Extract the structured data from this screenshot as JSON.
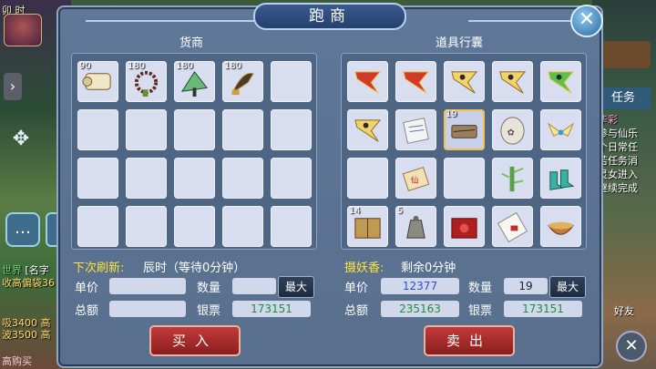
{
  "hud": {
    "time": "卯 时",
    "channel_label": "世界",
    "channel_text": "[名字",
    "line1": "收高偏袋36",
    "line2": "吸3400 高",
    "line3": "波3500 高",
    "bunny": "高购买",
    "task_tab": "任务",
    "task_lines": [
      "华彩",
      "参与仙乐",
      "个日常任",
      "若任务消",
      "灵女进入",
      "继续完成"
    ],
    "friend": "好友"
  },
  "window": {
    "title": "跑商",
    "close_icon": "close-icon"
  },
  "shop": {
    "title": "货商",
    "items": [
      {
        "qty": "90",
        "icon": "scroll-icon"
      },
      {
        "qty": "180",
        "icon": "beads-icon"
      },
      {
        "qty": "180",
        "icon": "fan-icon"
      },
      {
        "qty": "180",
        "icon": "dagger-icon"
      },
      {
        "qty": "",
        "icon": ""
      },
      {
        "qty": "",
        "icon": ""
      },
      {
        "qty": "",
        "icon": ""
      },
      {
        "qty": "",
        "icon": ""
      },
      {
        "qty": "",
        "icon": ""
      },
      {
        "qty": "",
        "icon": ""
      },
      {
        "qty": "",
        "icon": ""
      },
      {
        "qty": "",
        "icon": ""
      },
      {
        "qty": "",
        "icon": ""
      },
      {
        "qty": "",
        "icon": ""
      },
      {
        "qty": "",
        "icon": ""
      },
      {
        "qty": "",
        "icon": ""
      },
      {
        "qty": "",
        "icon": ""
      },
      {
        "qty": "",
        "icon": ""
      },
      {
        "qty": "",
        "icon": ""
      },
      {
        "qty": "",
        "icon": ""
      }
    ],
    "refresh_label": "下次刷新:",
    "refresh_value": "辰时（等待0分钟）",
    "price_label": "单价",
    "price_value": "",
    "qty_label": "数量",
    "qty_value": "",
    "max_label": "最大",
    "total_label": "总额",
    "total_value": "",
    "silver_label": "银票",
    "silver_value": "173151",
    "buy_label": "买入"
  },
  "bag": {
    "title": "道具行囊",
    "items": [
      {
        "qty": "",
        "icon": "red-flag-icon"
      },
      {
        "qty": "",
        "icon": "red-flag-icon"
      },
      {
        "qty": "",
        "icon": "yellow-flag-icon"
      },
      {
        "qty": "",
        "icon": "yellow-flag-icon"
      },
      {
        "qty": "",
        "icon": "green-flag-icon"
      },
      {
        "qty": "",
        "icon": "yellow-flag-icon"
      },
      {
        "qty": "",
        "icon": "paper-icon"
      },
      {
        "qty": "19",
        "icon": "incense-icon"
      },
      {
        "qty": "",
        "icon": "stone-icon"
      },
      {
        "qty": "",
        "icon": "wings-icon"
      },
      {
        "qty": "",
        "icon": ""
      },
      {
        "qty": "",
        "icon": "seal-scroll-icon"
      },
      {
        "qty": "",
        "icon": ""
      },
      {
        "qty": "",
        "icon": "bamboo-icon"
      },
      {
        "qty": "",
        "icon": "boots-icon"
      },
      {
        "qty": "14",
        "icon": "book-icon"
      },
      {
        "qty": "5",
        "icon": "bell-icon"
      },
      {
        "qty": "",
        "icon": "red-box-icon"
      },
      {
        "qty": "",
        "icon": "letter-icon"
      },
      {
        "qty": "",
        "icon": "bowl-icon"
      }
    ],
    "incense_label": "摄妖香:",
    "incense_value": "剩余0分钟",
    "price_label": "单价",
    "price_value": "12377",
    "qty_label": "数量",
    "qty_value": "19",
    "max_label": "最大",
    "total_label": "总额",
    "total_value": "235163",
    "silver_label": "银票",
    "silver_value": "173151",
    "sell_label": "卖出"
  }
}
